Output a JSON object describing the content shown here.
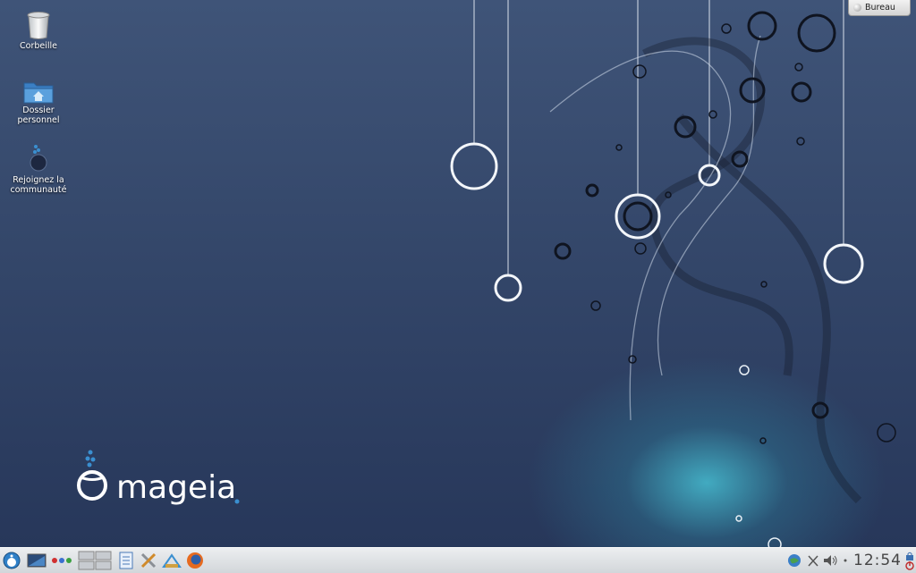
{
  "desktop": {
    "icons": [
      {
        "name": "trash",
        "label": "Corbeille"
      },
      {
        "name": "home",
        "label": "Dossier\npersonnel"
      },
      {
        "name": "community",
        "label": "Rejoignez la\ncommunauté"
      }
    ]
  },
  "widget": {
    "label": "Bureau"
  },
  "logo": {
    "text": "mageia"
  },
  "taskbar": {
    "clock": "12:54",
    "launchers": [
      "app-menu-icon",
      "show-desktop-icon",
      "activities-icon",
      "pager-icon",
      "notes-icon",
      "tools-icon",
      "install-icon",
      "firefox-icon"
    ],
    "tray": [
      "network-icon",
      "clipboard-icon",
      "volume-icon",
      "notifications-icon"
    ]
  },
  "colors": {
    "accent": "#3a8fd0",
    "taskbar": "#dfe2e5",
    "desktop": "#34476a"
  }
}
